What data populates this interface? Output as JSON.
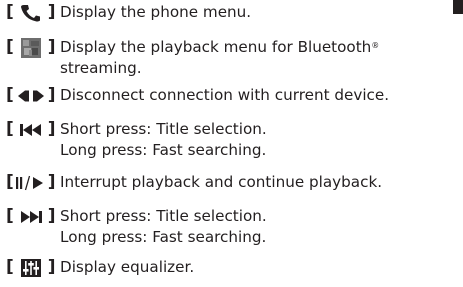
{
  "rows": [
    {
      "icon": "phone-icon",
      "lines": [
        "Display the phone menu."
      ]
    },
    {
      "icon": "bluetooth-playback-icon",
      "lines": [
        "Display the playback menu for Bluetooth",
        "streaming."
      ],
      "sup": "®"
    },
    {
      "icon": "disconnect-icon",
      "lines": [
        "Disconnect connection with current device."
      ]
    },
    {
      "icon": "previous-track-icon",
      "lines": [
        "Short press: Title selection.",
        "Long press: Fast searching."
      ]
    },
    {
      "icon": "pause-play-icon",
      "lines": [
        "Interrupt playback and continue playback."
      ]
    },
    {
      "icon": "next-track-icon",
      "lines": [
        "Short press: Title selection.",
        "Long press: Fast searching."
      ]
    },
    {
      "icon": "equalizer-icon",
      "lines": [
        "Display equalizer."
      ]
    }
  ],
  "brackets": {
    "open": "[",
    "close": "]"
  },
  "colors": {
    "text": "#231f20",
    "icon_gray": "#8c8c8c"
  }
}
